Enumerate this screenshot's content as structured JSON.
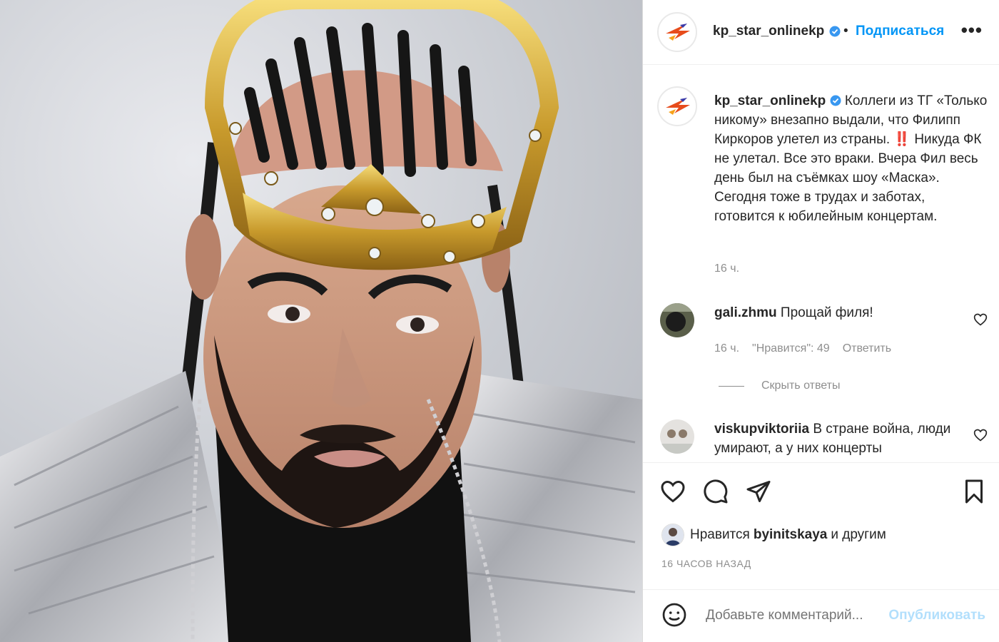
{
  "header": {
    "username": "kp_star_onlinekp",
    "dot": "•",
    "follow_label": "Подписаться",
    "more_label": "•••"
  },
  "caption": {
    "username": "kp_star_onlinekp",
    "text": "Коллеги из ТГ «Только никому» внезапно выдали, что Филипп Киркоров улетел из страны. ‼️ Никуда ФК не улетал. Все это враки. Вчера Фил весь день был на съёмках шоу «Маска». Сегодня тоже в трудах и заботах, готовится к юбилейным концертам.",
    "age": "16 ч."
  },
  "comments": [
    {
      "username": "gali.zhmu",
      "text": "Прощай филя!",
      "age": "16 ч.",
      "likes": "\"Нравится\": 49",
      "reply_label": "Ответить",
      "hide_replies_label": "Скрыть ответы"
    },
    {
      "username": "viskupviktoriia",
      "text": "В стране война, люди умирают, а у них концерты"
    }
  ],
  "likes": {
    "prefix": "Нравится",
    "user": "byinitskaya",
    "suffix": "и другим"
  },
  "timestamp": "16 ЧАСОВ НАЗАД",
  "comment_input": {
    "placeholder": "Добавьте комментарий...",
    "post_label": "Опубликовать"
  },
  "colors": {
    "accent": "#0095f6",
    "post_disabled": "#b2dffc",
    "muted": "#8e8e8e",
    "verified": "#3897f0"
  },
  "icons": [
    "heart-icon",
    "comment-icon",
    "share-icon",
    "bookmark-icon",
    "verified-icon",
    "smile-icon"
  ]
}
